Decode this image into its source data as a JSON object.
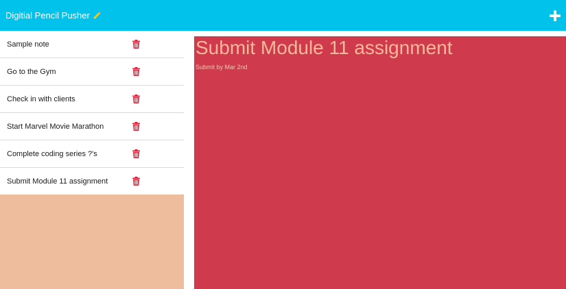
{
  "navbar": {
    "brand": "Digitial Pencil Pusher",
    "brand_icon": "pencil-icon",
    "add_icon": "plus-icon"
  },
  "colors": {
    "navbar": "#00c2ea",
    "sidebar_bg": "#edbd9d",
    "main_bg": "#cf3a4d",
    "trash": "#e0273f",
    "heading_text": "#f4b89a"
  },
  "notes": [
    {
      "title": "Sample note",
      "delete_icon": "trash-icon"
    },
    {
      "title": "Go to the Gym",
      "delete_icon": "trash-icon"
    },
    {
      "title": "Check in with clients",
      "delete_icon": "trash-icon"
    },
    {
      "title": "Start Marvel Movie Marathon",
      "delete_icon": "trash-icon"
    },
    {
      "title": "Complete coding series ?'s",
      "delete_icon": "trash-icon"
    },
    {
      "title": "Submit Module 11 assignment",
      "delete_icon": "trash-icon"
    }
  ],
  "active_note": {
    "title": "Submit Module 11 assignment",
    "text": "Submit by Mar 2nd"
  }
}
